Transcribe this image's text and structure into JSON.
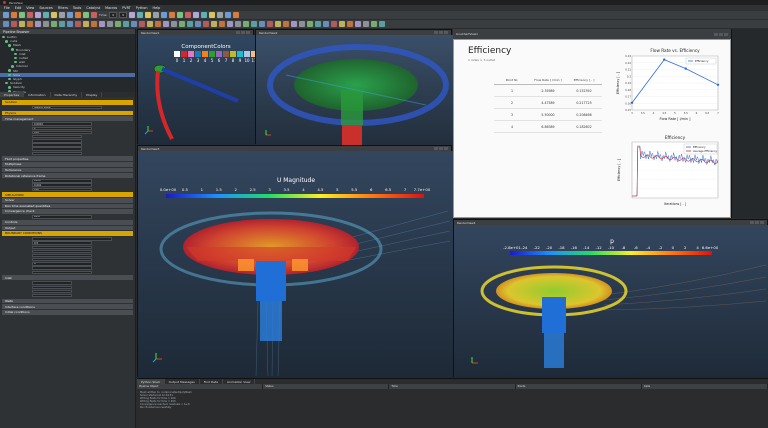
{
  "window": {
    "title": "ParaView"
  },
  "menu": [
    "File",
    "Edit",
    "View",
    "Sources",
    "Filters",
    "Tools",
    "Catalyst",
    "Macros",
    "PVRT",
    "Python",
    "Help"
  ],
  "toolbar": {
    "time_label": "Time:",
    "time_value": "0",
    "frame_value": "0"
  },
  "pipeline": {
    "title": "Pipeline Browser",
    "items": [
      "builtin:",
      "  cuda",
      "    Mesh",
      "      Boundary",
      "        inlet",
      "        outlet",
      "        wall",
      "      Internal",
      "    Stir",
      "    Slice",
      "    Glyph",
      "  Solution",
      "    Velocity",
      "    Pressure"
    ]
  },
  "properties": {
    "tabs": [
      "Properties",
      "Information",
      "Data Hierarchy",
      "Display"
    ],
    "sections": {
      "solution": "Solution",
      "physics": "Physics",
      "time_mgmt": "Time management",
      "fluid": "Fluid properties",
      "multiphase": "Multiphase",
      "turbulence": "Turbulence",
      "rotating": "Rotational reference frame",
      "simulation": "SIMULATION",
      "solver": "Solver",
      "runtime": "Run time evaluated quantities",
      "convergence": "Convergence check",
      "controls": "Controls",
      "output": "Output",
      "boundary": "BOUNDARY CONDITIONS",
      "inlet": "Inlet",
      "walls": "Walls",
      "interface": "Interface conditions",
      "initial": "Initial conditions"
    },
    "fields": {
      "solution_type": "Steady state",
      "time_step": "0.0001",
      "end_time": "2",
      "write_interval": "100",
      "density": "1000",
      "viscosity": "0.001",
      "rotation": "100",
      "tolerance": "1e-6",
      "velocity": "0.5",
      "pressure": "0"
    }
  },
  "viewports": {
    "tl_title": "RenderView1",
    "tr_title": "RenderView2",
    "ml_title": "RenderView3",
    "mr_title": "LineChartView1",
    "br_title": "RenderView4",
    "component_colors": {
      "title": "ComponentColors",
      "labels": [
        "0",
        "1",
        "2",
        "3",
        "4",
        "5",
        "6",
        "7",
        "8",
        "9",
        "10",
        "11"
      ],
      "colors": [
        "#ffffff",
        "#d62728",
        "#e377c2",
        "#1f77b4",
        "#ff7f0e",
        "#2ca02c",
        "#9467bd",
        "#8c564b",
        "#bcbd22",
        "#17becf",
        "#aec7e8",
        "#ffbb78"
      ]
    },
    "u_mag": {
      "title": "U Magnitude",
      "ticks": [
        "0.0e+00",
        "0.5",
        "1",
        "1.5",
        "2",
        "2.5",
        "3",
        "3.5",
        "4",
        "4.5",
        "5",
        "5.5",
        "6",
        "6.5",
        "7",
        "7.7e+00"
      ]
    },
    "pressure": {
      "title": "p",
      "ticks": [
        "-2.8e+01",
        "-24",
        "-22",
        "-20",
        "-18",
        "-16",
        "-14",
        "-12",
        "-10",
        "-8",
        "-6",
        "-4",
        "-2",
        "0",
        "2",
        "4",
        "6.6e+00"
      ]
    }
  },
  "efficiency": {
    "title": "Efficiency",
    "subtitle": "1 index × 3 outlet",
    "table_headers": [
      "Point Nr.",
      "Flow Rate [ l/min ]",
      "Efficiency [ - ]"
    ],
    "rows": [
      [
        "1",
        "2.35989",
        "0.152392"
      ],
      [
        "2",
        "4.47589",
        "0.217725"
      ],
      [
        "3",
        "5.50000",
        "0.208466"
      ],
      [
        "4",
        "6.86389",
        "0.182602"
      ]
    ],
    "chart_title": "Flow Rate   vs. Efficiency"
  },
  "chart_data": [
    {
      "type": "line",
      "title": "Flow Rate   vs. Efficiency",
      "xlabel": "Flow Rate [ l/min ]",
      "ylabel": "Efficiency [ - ]",
      "xlim": [
        3,
        7
      ],
      "ylim": [
        0.14,
        0.23
      ],
      "x": [
        3.0,
        4.5,
        5.5,
        7.0
      ],
      "series": [
        {
          "name": "Efficiency",
          "values": [
            0.152,
            0.224,
            0.209,
            0.182
          ]
        }
      ],
      "xticks": [
        "3",
        "3.5",
        "4",
        "4.5",
        "5",
        "5.5",
        "6",
        "6.5",
        "7"
      ],
      "yticks": [
        "0.15",
        "0.16",
        "0.17",
        "0.18",
        "0.19",
        "0.2",
        "0.21",
        "0.22",
        "0.23"
      ],
      "legend": "top-right"
    },
    {
      "type": "line",
      "title": "Efficiency",
      "xlabel": "Iterations [ - ]",
      "ylabel": "Efficiency [ - ]",
      "xlim": [
        0,
        1000
      ],
      "ylim": [
        0,
        0.25
      ],
      "series": [
        {
          "name": "Efficiency",
          "color": "#2a6fdb"
        },
        {
          "name": "Average Efficiency",
          "color": "#d62728"
        }
      ],
      "legend": "top-right"
    }
  ],
  "bottom": {
    "tabs": [
      "Python Shell",
      "Output Messages",
      "Find Data",
      "Animation View"
    ],
    "log": [
      "Mesh written to: cuda/constant/polyMesh",
      "Solver started at 12:04:51",
      "Writing fields for time = 100",
      "Writing fields for time = 200",
      "Convergence reached: residuals < 1e-6",
      "Run finished successfully"
    ],
    "columns": [
      "Pipeline Object",
      "Status",
      "Time",
      "Points",
      "Cells"
    ]
  }
}
